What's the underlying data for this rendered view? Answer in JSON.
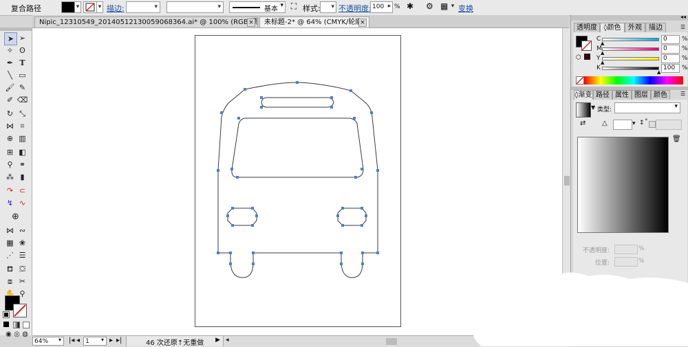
{
  "control_bar": {
    "object_type": "复合路径",
    "fill_color": "#000000",
    "stroke_label": "描边:",
    "brush_label": "基本",
    "style_label": "样式:",
    "opacity_label": "不透明度:",
    "opacity_value": "100",
    "opacity_unit": "%",
    "transform_label": "变换"
  },
  "doc_tabs": [
    {
      "label": "Nipic_12310549_20140512130059068364.ai* @ 100% (RGB/预览)"
    },
    {
      "label": "未标题-2* @ 64% (CMYK/轮廓)"
    }
  ],
  "status_bar": {
    "zoom": "64%",
    "artboard_number": "1",
    "undo_text": "46 次还原↑无重做"
  },
  "color_panel": {
    "tabs": [
      "透明度",
      "颜色",
      "外观",
      "描边"
    ],
    "channels": [
      {
        "name": "C",
        "value": "0"
      },
      {
        "name": "M",
        "value": "0"
      },
      {
        "name": "Y",
        "value": "0"
      },
      {
        "name": "K",
        "value": "100"
      }
    ]
  },
  "gradient_panel": {
    "tabs": [
      "渐变",
      "路径",
      "属性",
      "图层",
      "颜色"
    ],
    "type_label": "类型:",
    "angle_symbol": "△",
    "ratio_symbol": "°",
    "opacity_label": "不透明度:",
    "opacity_unit": "%",
    "location_label": "位置:",
    "location_unit": "%"
  },
  "colors": {
    "accent_link": "#1a4fa0",
    "selection_blue": "#3f6fd0",
    "anchor_blue": "#4a7fd6"
  }
}
